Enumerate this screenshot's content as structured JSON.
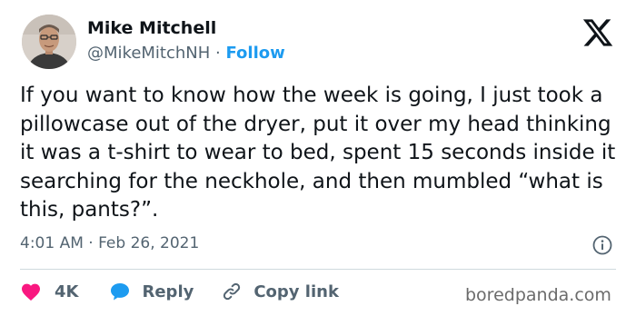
{
  "author": {
    "name": "Mike Mitchell",
    "handle": "@MikeMitchNH",
    "separator": "·",
    "follow_label": "Follow"
  },
  "tweet": {
    "text": "If you want to know how the week is going, I just took a pillowcase out of the dryer, put it over my head thinking it was a t-shirt to wear to bed, spent 15 seconds inside it searching for the neckhole, and then mumbled “what is this, pants?”.",
    "timestamp": "4:01 AM · Feb 26, 2021"
  },
  "actions": {
    "like_count": "4K",
    "reply_label": "Reply",
    "copy_link_label": "Copy link"
  },
  "watermark": "boredpanda.com",
  "colors": {
    "like": "#f91880",
    "reply": "#1d9bf0",
    "follow": "#1d9bf0",
    "secondary_text": "#536471"
  },
  "icons": [
    "x-logo-icon",
    "info-icon",
    "heart-icon",
    "reply-bubble-icon",
    "link-icon"
  ]
}
